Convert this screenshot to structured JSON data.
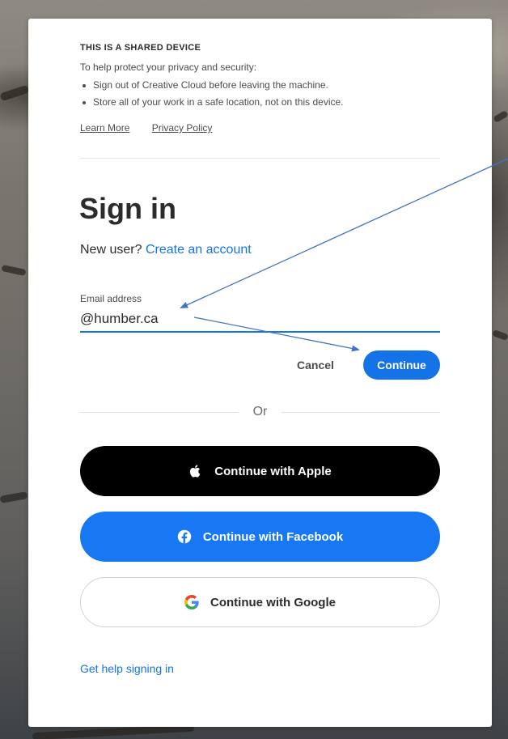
{
  "shared_device": {
    "title": "THIS IS A SHARED DEVICE",
    "intro": "To help protect your privacy and security:",
    "bullets": [
      "Sign out of Creative Cloud before leaving the machine.",
      "Store all of your work in a safe location, not on this device."
    ],
    "learn_more": "Learn More",
    "privacy_policy": "Privacy Policy"
  },
  "signin": {
    "heading": "Sign in",
    "new_user_prefix": "New user?",
    "create_account": "Create an account",
    "email_label": "Email address",
    "email_value": "@humber.ca",
    "cancel_label": "Cancel",
    "continue_label": "Continue",
    "or_label": "Or"
  },
  "social": {
    "apple_label": "Continue with Apple",
    "facebook_label": "Continue with Facebook",
    "google_label": "Continue with Google"
  },
  "help": {
    "label": "Get help signing in"
  },
  "colors": {
    "accent": "#1473e6",
    "facebook": "#1877f2",
    "annotation_arrow": "#4472c4"
  },
  "icons": {
    "apple": "apple-icon",
    "facebook": "facebook-icon",
    "google": "google-icon"
  }
}
